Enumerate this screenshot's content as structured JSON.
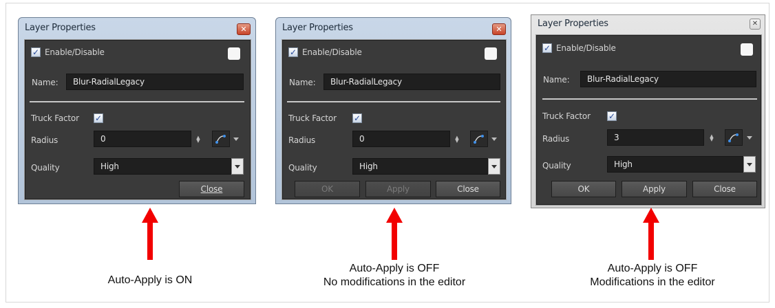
{
  "colors": {
    "arrow": "#f20000",
    "panel_bg": "#3a3a3a",
    "field_bg": "#1f1f1f"
  },
  "icons": [
    "close-icon",
    "checkmark-icon",
    "spin-arrows-icon",
    "function-curve-icon",
    "dropdown-arrow-icon"
  ],
  "dialogs": [
    {
      "title": "Layer Properties",
      "enable_label": "Enable/Disable",
      "enable_checked": true,
      "name_label": "Name:",
      "name_value": "Blur-RadialLegacy",
      "truck_factor_label": "Truck Factor",
      "truck_factor_checked": true,
      "radius_label": "Radius",
      "radius_value": "0",
      "quality_label": "Quality",
      "quality_value": "High",
      "close_label": "Close",
      "caption": [
        "Auto-Apply is ON"
      ]
    },
    {
      "title": "Layer Properties",
      "enable_label": "Enable/Disable",
      "enable_checked": true,
      "name_label": "Name:",
      "name_value": "Blur-RadialLegacy",
      "truck_factor_label": "Truck Factor",
      "truck_factor_checked": true,
      "radius_label": "Radius",
      "radius_value": "0",
      "quality_label": "Quality",
      "quality_value": "High",
      "ok_label": "OK",
      "apply_label": "Apply",
      "close_label": "Close",
      "ok_enabled": false,
      "apply_enabled": false,
      "caption": [
        "Auto-Apply is OFF",
        "No modifications in the editor"
      ]
    },
    {
      "title": "Layer Properties",
      "enable_label": "Enable/Disable",
      "enable_checked": true,
      "name_label": "Name:",
      "name_value": "Blur-RadialLegacy",
      "truck_factor_label": "Truck Factor",
      "truck_factor_checked": true,
      "radius_label": "Radius",
      "radius_value": "3",
      "quality_label": "Quality",
      "quality_value": "High",
      "ok_label": "OK",
      "apply_label": "Apply",
      "close_label": "Close",
      "ok_enabled": true,
      "apply_enabled": true,
      "caption": [
        "Auto-Apply is OFF",
        "Modifications in the editor"
      ]
    }
  ]
}
